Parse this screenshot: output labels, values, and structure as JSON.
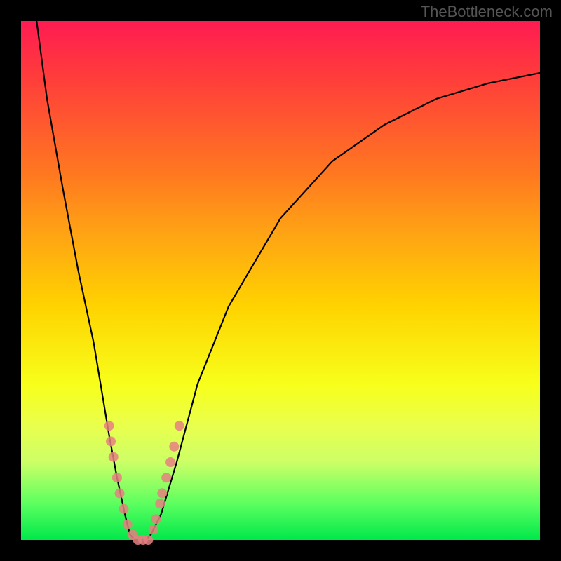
{
  "watermark": "TheBottleneck.com",
  "chart_data": {
    "type": "line",
    "title": "",
    "xlabel": "",
    "ylabel": "",
    "xlim": [
      0,
      100
    ],
    "ylim": [
      0,
      100
    ],
    "grid": false,
    "legend": false,
    "series": [
      {
        "name": "bottleneck-curve",
        "color": "#000000",
        "x": [
          3,
          5,
          8,
          11,
          14,
          17,
          18.5,
          20,
          21,
          22,
          23,
          24,
          25,
          27,
          30,
          34,
          40,
          50,
          60,
          70,
          80,
          90,
          100
        ],
        "values": [
          100,
          85,
          68,
          52,
          38,
          20,
          12,
          5,
          1,
          0,
          0,
          0,
          1,
          5,
          15,
          30,
          45,
          62,
          73,
          80,
          85,
          88,
          90
        ]
      }
    ],
    "markers": [
      {
        "name": "cluster-markers",
        "color": "#e68080",
        "points": [
          {
            "x": 17.0,
            "y": 22
          },
          {
            "x": 17.3,
            "y": 19
          },
          {
            "x": 17.8,
            "y": 16
          },
          {
            "x": 18.5,
            "y": 12
          },
          {
            "x": 19.0,
            "y": 9
          },
          {
            "x": 19.8,
            "y": 6
          },
          {
            "x": 20.5,
            "y": 3
          },
          {
            "x": 21.5,
            "y": 1
          },
          {
            "x": 22.5,
            "y": 0
          },
          {
            "x": 23.5,
            "y": 0
          },
          {
            "x": 24.5,
            "y": 0
          },
          {
            "x": 25.5,
            "y": 2
          },
          {
            "x": 26.0,
            "y": 4
          },
          {
            "x": 26.8,
            "y": 7
          },
          {
            "x": 27.2,
            "y": 9
          },
          {
            "x": 28.0,
            "y": 12
          },
          {
            "x": 28.8,
            "y": 15
          },
          {
            "x": 29.5,
            "y": 18
          },
          {
            "x": 30.5,
            "y": 22
          }
        ]
      }
    ],
    "gradient_stops": [
      {
        "pos": 0.0,
        "color": "#ff1b52"
      },
      {
        "pos": 0.1,
        "color": "#ff3a3c"
      },
      {
        "pos": 0.2,
        "color": "#ff5a2e"
      },
      {
        "pos": 0.3,
        "color": "#ff7a1f"
      },
      {
        "pos": 0.4,
        "color": "#ffa015"
      },
      {
        "pos": 0.55,
        "color": "#ffd300"
      },
      {
        "pos": 0.7,
        "color": "#f7ff1a"
      },
      {
        "pos": 0.78,
        "color": "#e9ff4d"
      },
      {
        "pos": 0.85,
        "color": "#ccff66"
      },
      {
        "pos": 0.93,
        "color": "#5cff60"
      },
      {
        "pos": 1.0,
        "color": "#00e84a"
      }
    ]
  }
}
